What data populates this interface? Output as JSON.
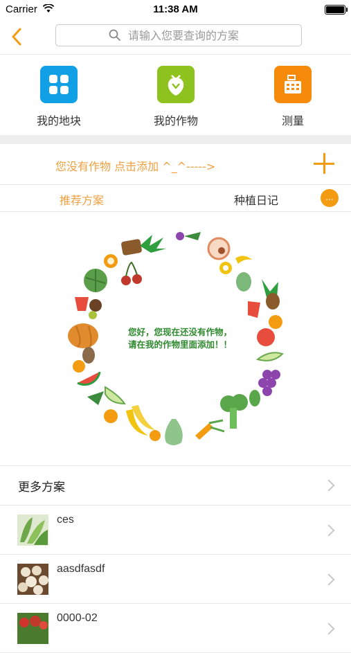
{
  "status": {
    "carrier": "Carrier",
    "time": "11:38 AM"
  },
  "search": {
    "placeholder": "请输入您要查询的方案"
  },
  "shortcuts": [
    {
      "label": "我的地块",
      "color": "#11a0e6",
      "icon": "grid-icon"
    },
    {
      "label": "我的作物",
      "color": "#8dc21f",
      "icon": "crop-icon"
    },
    {
      "label": "测量",
      "color": "#f58a0b",
      "icon": "register-icon"
    }
  ],
  "add_bar": {
    "message": "您没有作物 点击添加  ^_^----->"
  },
  "tabs": {
    "recommended": "推荐方案",
    "diary": "种植日记",
    "more": "..."
  },
  "empty_state": {
    "line1": "您好，您现在还没有作物，",
    "line2": "请在我的作物里面添加！！"
  },
  "more_plans": {
    "title": "更多方案",
    "items": [
      {
        "name": "ces"
      },
      {
        "name": "aasdfasdf"
      },
      {
        "name": "0000-02"
      }
    ]
  },
  "colors": {
    "accent": "#f39c12"
  }
}
